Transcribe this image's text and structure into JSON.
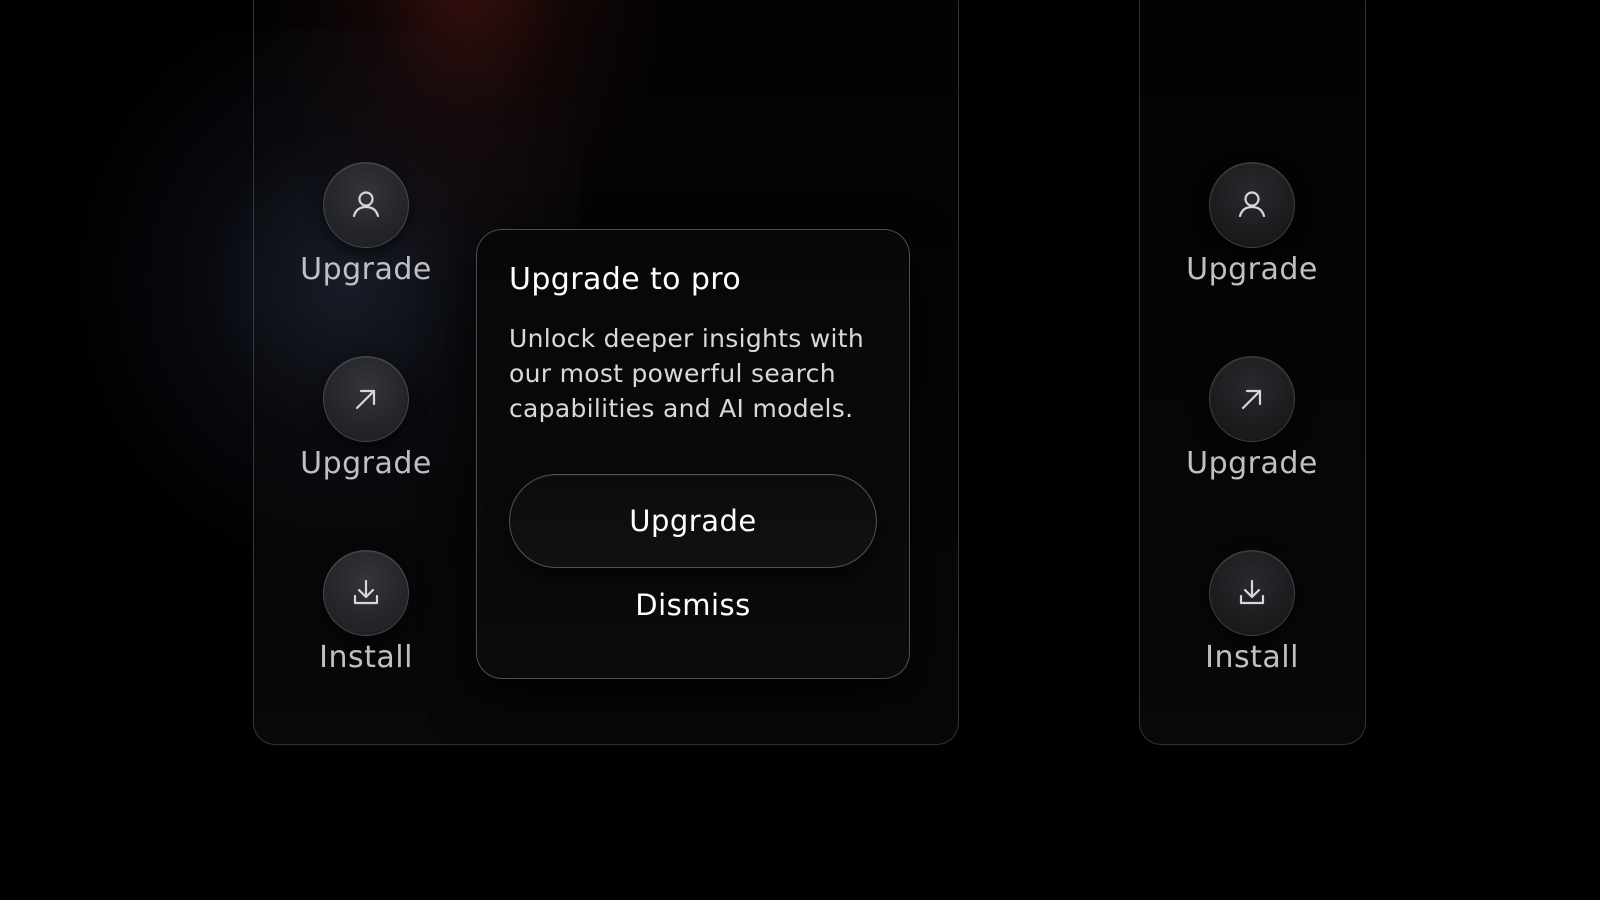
{
  "rail_left": {
    "items": [
      {
        "label": "Upgrade",
        "icon": "user-icon"
      },
      {
        "label": "Upgrade",
        "icon": "arrow-up-right-icon"
      },
      {
        "label": "Install",
        "icon": "download-icon"
      }
    ]
  },
  "rail_right": {
    "items": [
      {
        "label": "Upgrade",
        "icon": "user-icon"
      },
      {
        "label": "Upgrade",
        "icon": "arrow-up-right-icon"
      },
      {
        "label": "Install",
        "icon": "download-icon"
      }
    ]
  },
  "popover": {
    "title": "Upgrade to pro",
    "body": "Unlock deeper insights with our most powerful search capabilities and AI models.",
    "primary_label": "Upgrade",
    "secondary_label": "Dismiss"
  },
  "colors": {
    "background": "#000000",
    "text_primary": "#ffffff",
    "text_muted": "#bfc0c4",
    "glow_blue": "#343e5c",
    "glow_red": "#781e1a"
  }
}
